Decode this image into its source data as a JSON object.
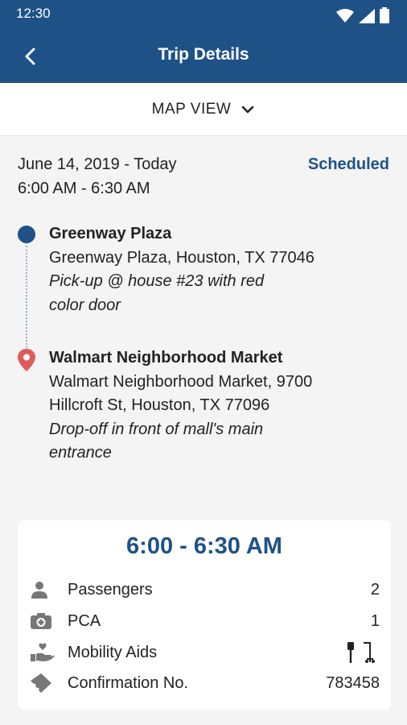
{
  "status_bar": {
    "time": "12:30",
    "icons": [
      "wifi-icon",
      "signal-icon",
      "battery-icon"
    ]
  },
  "app_bar": {
    "title": "Trip Details",
    "back_icon": "chevron-left-icon"
  },
  "map_toggle": {
    "label": "MAP VIEW",
    "icon": "chevron-down-icon"
  },
  "trip": {
    "date": "June 14, 2019 - Today",
    "time_range": "6:00 AM - 6:30 AM",
    "status": "Scheduled",
    "pickup": {
      "name": "Greenway Plaza",
      "address": "Greenway Plaza, Houston, TX 77046",
      "note_line1": "Pick-up @ house #23 with red",
      "note_line2": "color door"
    },
    "dropoff": {
      "name": "Walmart Neighborhood Market",
      "address_line1": "Walmart Neighborhood Market, 9700",
      "address_line2": "Hillcroft St, Houston, TX 77096",
      "note_line1": "Drop-off in front of mall's main",
      "note_line2": "entrance"
    }
  },
  "card": {
    "time": "6:00 - 6:30 AM",
    "rows": [
      {
        "icon": "person-icon",
        "label": "Passengers",
        "value": "2"
      },
      {
        "icon": "medical-kit-icon",
        "label": "PCA",
        "value": "1"
      },
      {
        "icon": "hand-heart-icon",
        "label": "Mobility Aids",
        "value_icons": [
          "cane-icon",
          "walker-icon"
        ]
      },
      {
        "icon": "ticket-icon",
        "label": "Confirmation No.",
        "value": "783458"
      }
    ]
  },
  "colors": {
    "primary": "#1e5287",
    "pin": "#e05a5a",
    "background": "#f4f4f4"
  }
}
